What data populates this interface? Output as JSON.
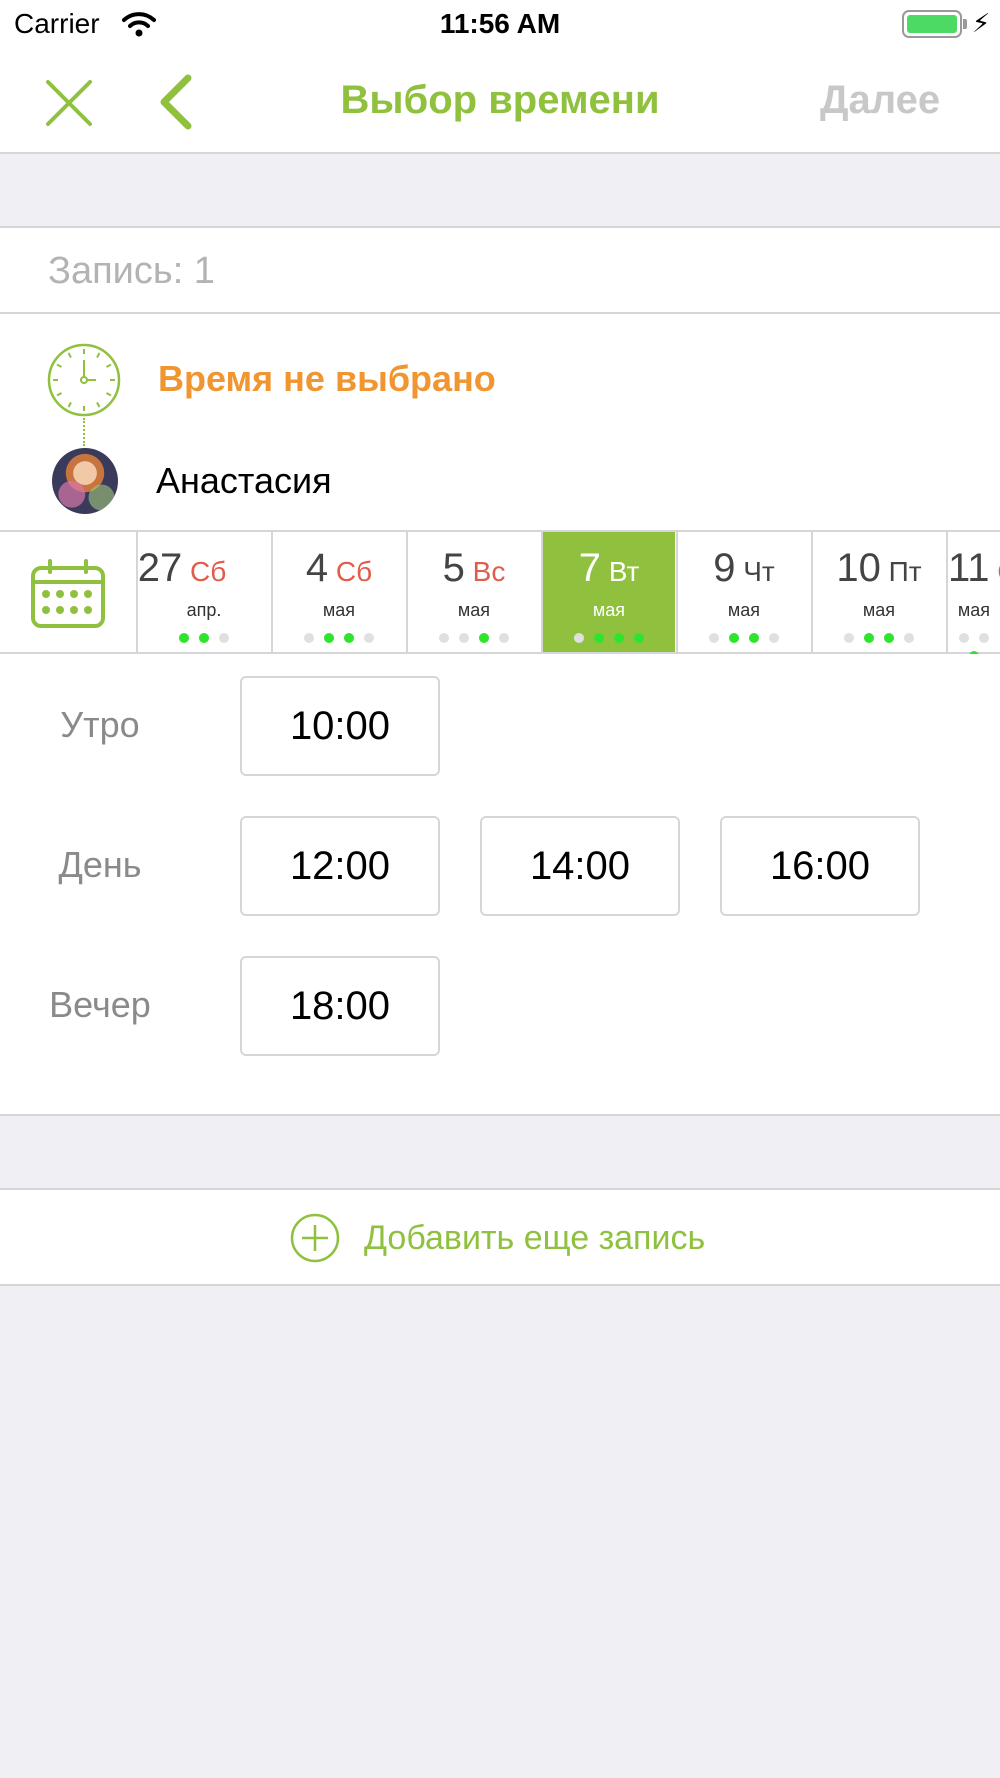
{
  "status_bar": {
    "carrier": "Carrier",
    "time": "11:56 AM"
  },
  "nav": {
    "title": "Выбор времени",
    "next_label": "Далее"
  },
  "record": {
    "label": "Запись: 1"
  },
  "booking": {
    "time_status": "Время не выбрано",
    "specialist_name": "Анастасия"
  },
  "dates": [
    {
      "day": "27",
      "weekday": "Сб",
      "month": "апр.",
      "weekend": true,
      "dots": [
        1,
        1,
        0
      ],
      "selected": false
    },
    {
      "day": "4",
      "weekday": "Сб",
      "month": "мая",
      "weekend": true,
      "dots": [
        0,
        1,
        1,
        0
      ],
      "selected": false
    },
    {
      "day": "5",
      "weekday": "Вс",
      "month": "мая",
      "weekend": true,
      "dots": [
        0,
        0,
        1,
        0
      ],
      "selected": false
    },
    {
      "day": "7",
      "weekday": "Вт",
      "month": "мая",
      "weekend": false,
      "dots": [
        0,
        1,
        1,
        1
      ],
      "selected": true
    },
    {
      "day": "9",
      "weekday": "Чт",
      "month": "мая",
      "weekend": false,
      "dots": [
        0,
        1,
        1,
        0
      ],
      "selected": false
    },
    {
      "day": "10",
      "weekday": "Пт",
      "month": "мая",
      "weekend": false,
      "dots": [
        0,
        1,
        1,
        0
      ],
      "selected": false
    },
    {
      "day": "11",
      "weekday": "Сб",
      "month": "мая",
      "weekend": true,
      "dots": [
        0,
        0,
        1
      ],
      "selected": false
    }
  ],
  "periods": [
    {
      "label": "Утро",
      "slots": [
        "10:00"
      ]
    },
    {
      "label": "День",
      "slots": [
        "12:00",
        "14:00",
        "16:00"
      ]
    },
    {
      "label": "Вечер",
      "slots": [
        "18:00"
      ]
    }
  ],
  "add_record": {
    "label": "Добавить еще запись"
  },
  "colors": {
    "accent": "#8fc13f",
    "warning": "#f0952f",
    "weekend": "#e25c4b",
    "dot_active": "#2ee52e"
  }
}
